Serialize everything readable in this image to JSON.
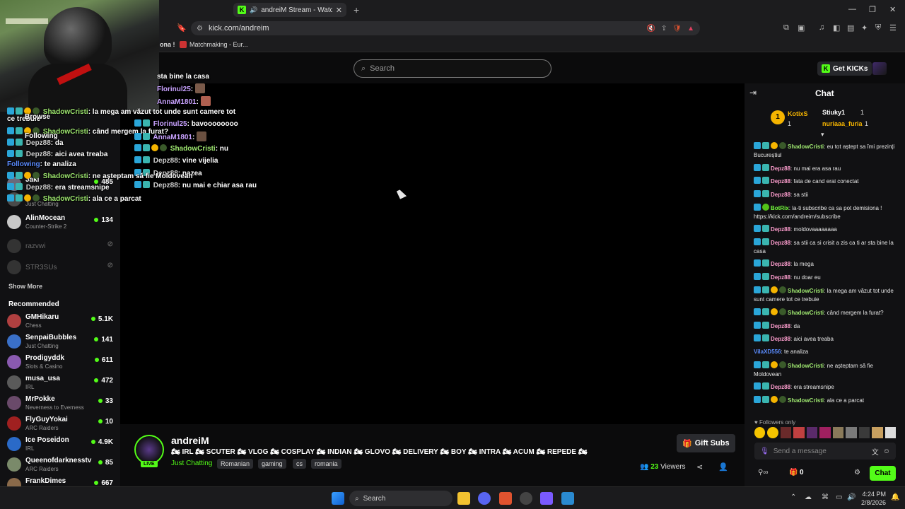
{
  "browser": {
    "tab_title": "andreiM Stream - Watch Live",
    "url": "kick.com/andreim",
    "bookmark_partial": "ona !",
    "bookmark": "Matchmaking - Eur..."
  },
  "nav": {
    "search_placeholder": "Search",
    "get_kicks": "Get KICKs"
  },
  "sidebar": {
    "browse": "Browse",
    "following_header": "Following",
    "following_tab": "Following",
    "followed": [
      {
        "name": "Jaki",
        "category": "",
        "viewers": "485"
      },
      {
        "name": "",
        "category": "Just Chatting",
        "viewers": ""
      },
      {
        "name": "AlinMocean",
        "category": "Counter-Strike 2",
        "viewers": "134"
      },
      {
        "name": "razvwi",
        "category": "",
        "viewers": ""
      },
      {
        "name": "STR3SUs",
        "category": "",
        "viewers": ""
      }
    ],
    "show_more": "Show More",
    "recommended_header": "Recommended",
    "recommended": [
      {
        "name": "GMHikaru",
        "category": "Chess",
        "viewers": "5.1K"
      },
      {
        "name": "SenpaiBubbles",
        "category": "Just Chatting",
        "viewers": "141"
      },
      {
        "name": "Prodigyddk",
        "category": "Slots & Casino",
        "viewers": "611"
      },
      {
        "name": "musa_usa",
        "category": "IRL",
        "viewers": "472"
      },
      {
        "name": "MrPokke",
        "category": "Neverness to Everness",
        "viewers": "33"
      },
      {
        "name": "FlyGuyYokai",
        "category": "ARC Raiders",
        "viewers": "10"
      },
      {
        "name": "Ice Poseidon",
        "category": "IRL",
        "viewers": "4.9K"
      },
      {
        "name": "Queenofdarknesstv",
        "category": "ARC Raiders",
        "viewers": "85"
      },
      {
        "name": "FrankDimes",
        "category": "",
        "viewers": "667"
      }
    ]
  },
  "overlay_chat": [
    {
      "user": "",
      "text": "sta bine la casa"
    },
    {
      "user": "Florinul25",
      "text": ""
    },
    {
      "user": "AnnaM1801",
      "text": ""
    },
    {
      "user": "ShadowCristi",
      "text": "la mega am văzut tot unde sunt camere tot"
    },
    {
      "user": "",
      "text": "ce trebuie"
    },
    {
      "user": "Florinul25",
      "text": "bavoooooooo"
    },
    {
      "user": "ShadowCristi",
      "text": "când mergem la furat?"
    },
    {
      "user": "AnnaM1801",
      "text": ""
    },
    {
      "user": "Depz88",
      "text": "da"
    },
    {
      "user": "ShadowCristi",
      "text": "nu"
    },
    {
      "user": "Depz88",
      "text": "aici avea treaba"
    },
    {
      "user": "Depz88",
      "text": "vine vijelia"
    },
    {
      "user": "",
      "text": "te analiza"
    },
    {
      "user": "Depz88",
      "text": "nazea"
    },
    {
      "user": "ShadowCristi",
      "text": "ne așteptam să fie Moldovean"
    },
    {
      "user": "Depz88",
      "text": "nu mai e chiar asa rau"
    },
    {
      "user": "Depz88",
      "text": "era streamsnipe"
    },
    {
      "user": "ShadowCristi",
      "text": "ala ce a parcat"
    }
  ],
  "stream": {
    "channel": "andreiM",
    "live": "LIVE",
    "title": "🏍 IRL 🏍 SCUTER 🏍 VLOG 🏍 COSPLAY 🏍 INDIAN 🏍 GLOVO 🏍 DELIVERY 🏍 BOY 🏍 INTRA 🏍 ACUM 🏍 REPEDE 🏍",
    "category": "Just Chatting",
    "tags": [
      "Romanian",
      "gaming",
      "cs",
      "romania"
    ],
    "gift_subs": "Gift Subs",
    "viewers_count": "23",
    "viewers_label": "Viewers"
  },
  "chat": {
    "title": "Chat",
    "gifters": [
      {
        "rank": "1",
        "name": "KotixS",
        "count": "1"
      },
      {
        "name": "Stiuky1",
        "count": "1"
      },
      {
        "name": "nuriaaa_furia",
        "count": "1"
      }
    ],
    "messages": [
      {
        "user": "ShadowCristi",
        "text": "eu tot aștept sa îmi prezinți Bucureștiul"
      },
      {
        "user": "Depz88",
        "text": "nu mai era asa rau"
      },
      {
        "user": "Depz88",
        "text": "fata de cand erai conectat"
      },
      {
        "user": "Depz88",
        "text": "sa stii"
      },
      {
        "user": "BotRix",
        "text": "la-ti subscribe ca sa pot demisiona ! https://kick.com/andreim/subscribe"
      },
      {
        "user": "Depz88",
        "text": "moldovaaaaaaaa"
      },
      {
        "user": "Depz88",
        "text": "sa stii ca si crisit a zis ca ti ar sta bine la casa"
      },
      {
        "user": "Depz88",
        "text": "la mega"
      },
      {
        "user": "Depz88",
        "text": "nu doar eu"
      },
      {
        "user": "ShadowCristi",
        "text": "la mega am văzut tot unde sunt camere tot ce trebuie"
      },
      {
        "user": "ShadowCristi",
        "text": "când mergem la furat?"
      },
      {
        "user": "Depz88",
        "text": "da"
      },
      {
        "user": "Depz88",
        "text": "aici avea treaba"
      },
      {
        "user": "VilaXD556",
        "text": "te analiza"
      },
      {
        "user": "ShadowCristi",
        "text": "ne așteptam să fie Moldovean"
      },
      {
        "user": "Depz88",
        "text": "era streamsnipe"
      },
      {
        "user": "ShadowCristi",
        "text": "ala ce a parcat"
      }
    ],
    "followers_only": "Followers only",
    "input_placeholder": "Send a message",
    "kicks_count": "0",
    "chat_button": "Chat"
  },
  "taskbar": {
    "search": "Search",
    "time": "4:24 PM",
    "date": "2/8/2026"
  },
  "colors": {
    "accent": "#53fc18",
    "background": "#0b0b0c",
    "panel": "#111113"
  }
}
